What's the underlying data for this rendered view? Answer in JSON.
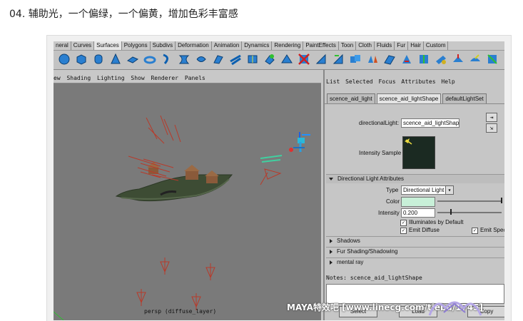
{
  "caption": "04. 辅助光，一个偏绿，一个偏黄，增加色彩丰富感",
  "shelf_tabs": [
    "neral",
    "Curves",
    "Surfaces",
    "Polygons",
    "Subdivs",
    "Deformation",
    "Animation",
    "Dynamics",
    "Rendering",
    "PaintEffects",
    "Toon",
    "Cloth",
    "Fluids",
    "Fur",
    "Hair",
    "Custom"
  ],
  "viewport": {
    "menu": [
      "ew",
      "Shading",
      "Lighting",
      "Show",
      "Renderer",
      "Panels"
    ],
    "camera_label": "persp (diffuse_layer)"
  },
  "attribute_editor": {
    "menu": [
      "List",
      "Selected",
      "Focus",
      "Attributes",
      "Help"
    ],
    "tabs": [
      "scence_aid_light",
      "scence_aid_lightShape",
      "defaultLightSet"
    ],
    "directional_light_label": "directionalLight:",
    "directional_light_value": "scence_aid_lightShape",
    "intensity_sample_label": "Intensity Sample",
    "section_directional": "Directional Light Attributes",
    "type_label": "Type",
    "type_value": "Directional Light",
    "color_label": "Color",
    "color_value": "#c8f0d8",
    "intensity_label": "Intensity",
    "intensity_value": "0.200",
    "illuminates_label": "Illuminates by Default",
    "emit_diffuse_label": "Emit Diffuse",
    "emit_specular_label": "Emit Spec",
    "section_shadows": "Shadows",
    "section_fur": "Fur Shading/Shadowing",
    "section_mental": "mental ray",
    "notes_label": "Notes: scence_aid_lightShape",
    "buttons": {
      "select": "Select",
      "load": "Load",
      "copy": "Copy"
    }
  },
  "watermark": "MAYA特效吧  [www.linecg.com/tieba/1745]"
}
